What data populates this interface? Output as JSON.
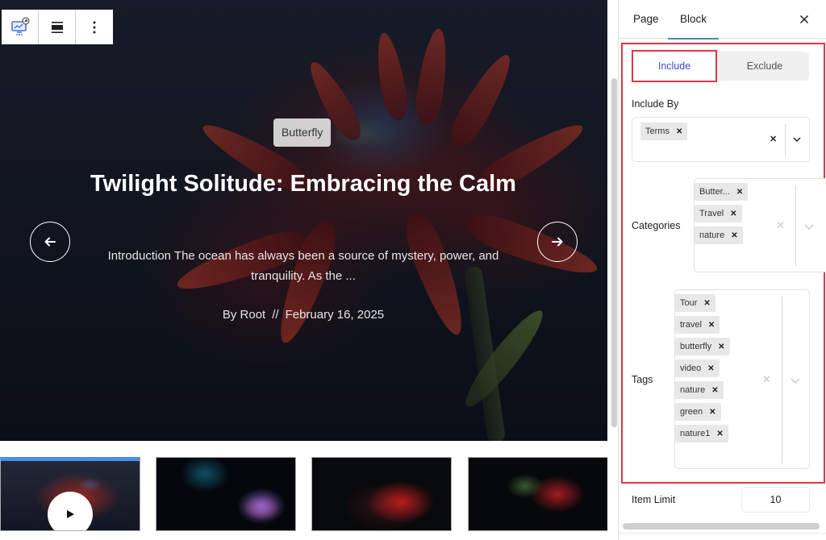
{
  "toolbar": {
    "items": [
      {
        "name": "block-type-button",
        "icon": "slider-chart-icon"
      },
      {
        "name": "align-button",
        "icon": "align-full-icon"
      },
      {
        "name": "more-options-button",
        "icon": "more-vertical-icon"
      }
    ]
  },
  "hero": {
    "category": "Butterfly",
    "title": "Twilight Solitude: Embracing the Calm",
    "excerpt": "Introduction The ocean has always been a source of mystery, power, and tranquility. As the ...",
    "author": "By Root",
    "separator": "//",
    "date": "February 16, 2025",
    "prev_icon": "arrow-left-icon",
    "next_icon": "arrow-right-icon"
  },
  "thumbnails": [
    {
      "label": "Red flower slide",
      "active": true,
      "has_video": true
    },
    {
      "label": "Blue lily slide",
      "active": false,
      "has_video": false
    },
    {
      "label": "Red leaf slide",
      "active": false,
      "has_video": false
    },
    {
      "label": "Red blossom slide",
      "active": false,
      "has_video": false
    }
  ],
  "sidebar": {
    "tabs": [
      {
        "label": "Page",
        "active": false
      },
      {
        "label": "Block",
        "active": true
      }
    ],
    "close_icon": "close-icon",
    "toggle": {
      "include": "Include",
      "exclude": "Exclude",
      "selected": "Include"
    },
    "include_by": {
      "label": "Include By",
      "chips": [
        "Terms"
      ]
    },
    "categories": {
      "label": "Categories",
      "chips": [
        "Butter...",
        "Travel",
        "nature"
      ]
    },
    "tags": {
      "label": "Tags",
      "chips": [
        "Tour",
        "travel",
        "butterfly",
        "video",
        "nature",
        "green",
        "nature1"
      ]
    },
    "item_limit": {
      "label": "Item Limit",
      "value": "10"
    }
  },
  "colors": {
    "highlight": "#d9394a",
    "include_text": "#3b4cc9",
    "tab_underline": "#3f8eaa",
    "active_thumb": "#4a8fe7"
  }
}
